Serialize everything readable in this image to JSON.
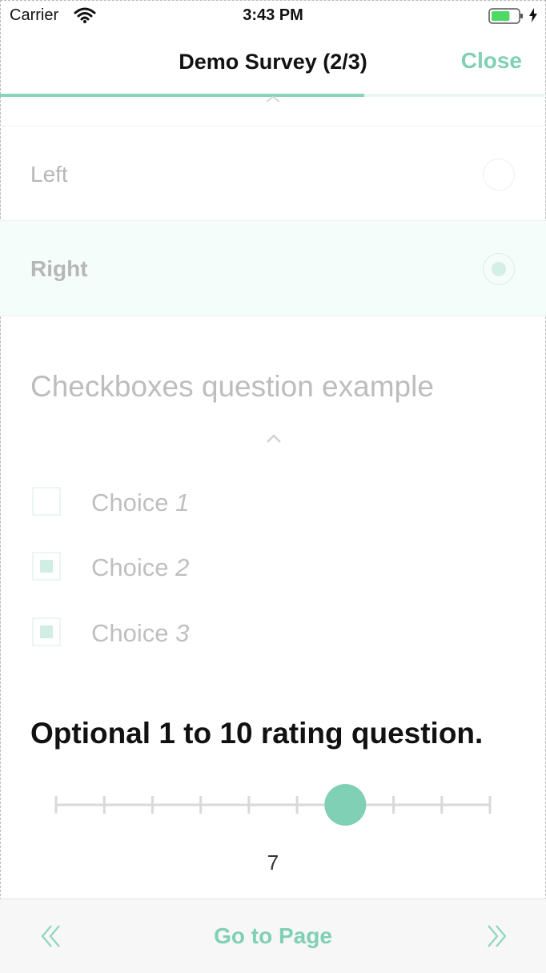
{
  "status_bar": {
    "carrier": "Carrier",
    "time": "3:43 PM",
    "wifi_icon": "wifi-icon",
    "battery_icon": "battery-icon",
    "charging_icon": "bolt-icon",
    "battery_level": 0.7
  },
  "nav": {
    "title": "Demo Survey (2/3)",
    "close_label": "Close",
    "progress": 0.667
  },
  "radio_question": {
    "options": [
      {
        "label": "Left",
        "selected": false
      },
      {
        "label": "Right",
        "selected": true
      }
    ]
  },
  "checkbox_question": {
    "title": "Checkboxes question example",
    "collapse_icon": "chevron-up-icon",
    "choices": [
      {
        "prefix": "Choice ",
        "num": "1",
        "checked": false
      },
      {
        "prefix": "Choice ",
        "num": "2",
        "checked": true
      },
      {
        "prefix": "Choice ",
        "num": "3",
        "checked": true
      }
    ]
  },
  "rating_question": {
    "title": "Optional 1 to 10 rating question.",
    "min": 1,
    "max": 10,
    "value": "7"
  },
  "bottom_bar": {
    "goto_label": "Go to Page",
    "prev_icon": "double-chevron-left-icon",
    "next_icon": "double-chevron-right-icon"
  },
  "colors": {
    "accent": "#7fd0b4",
    "selected_row_bg": "#f5fdfb",
    "faded_text": "#bdbdbd"
  }
}
